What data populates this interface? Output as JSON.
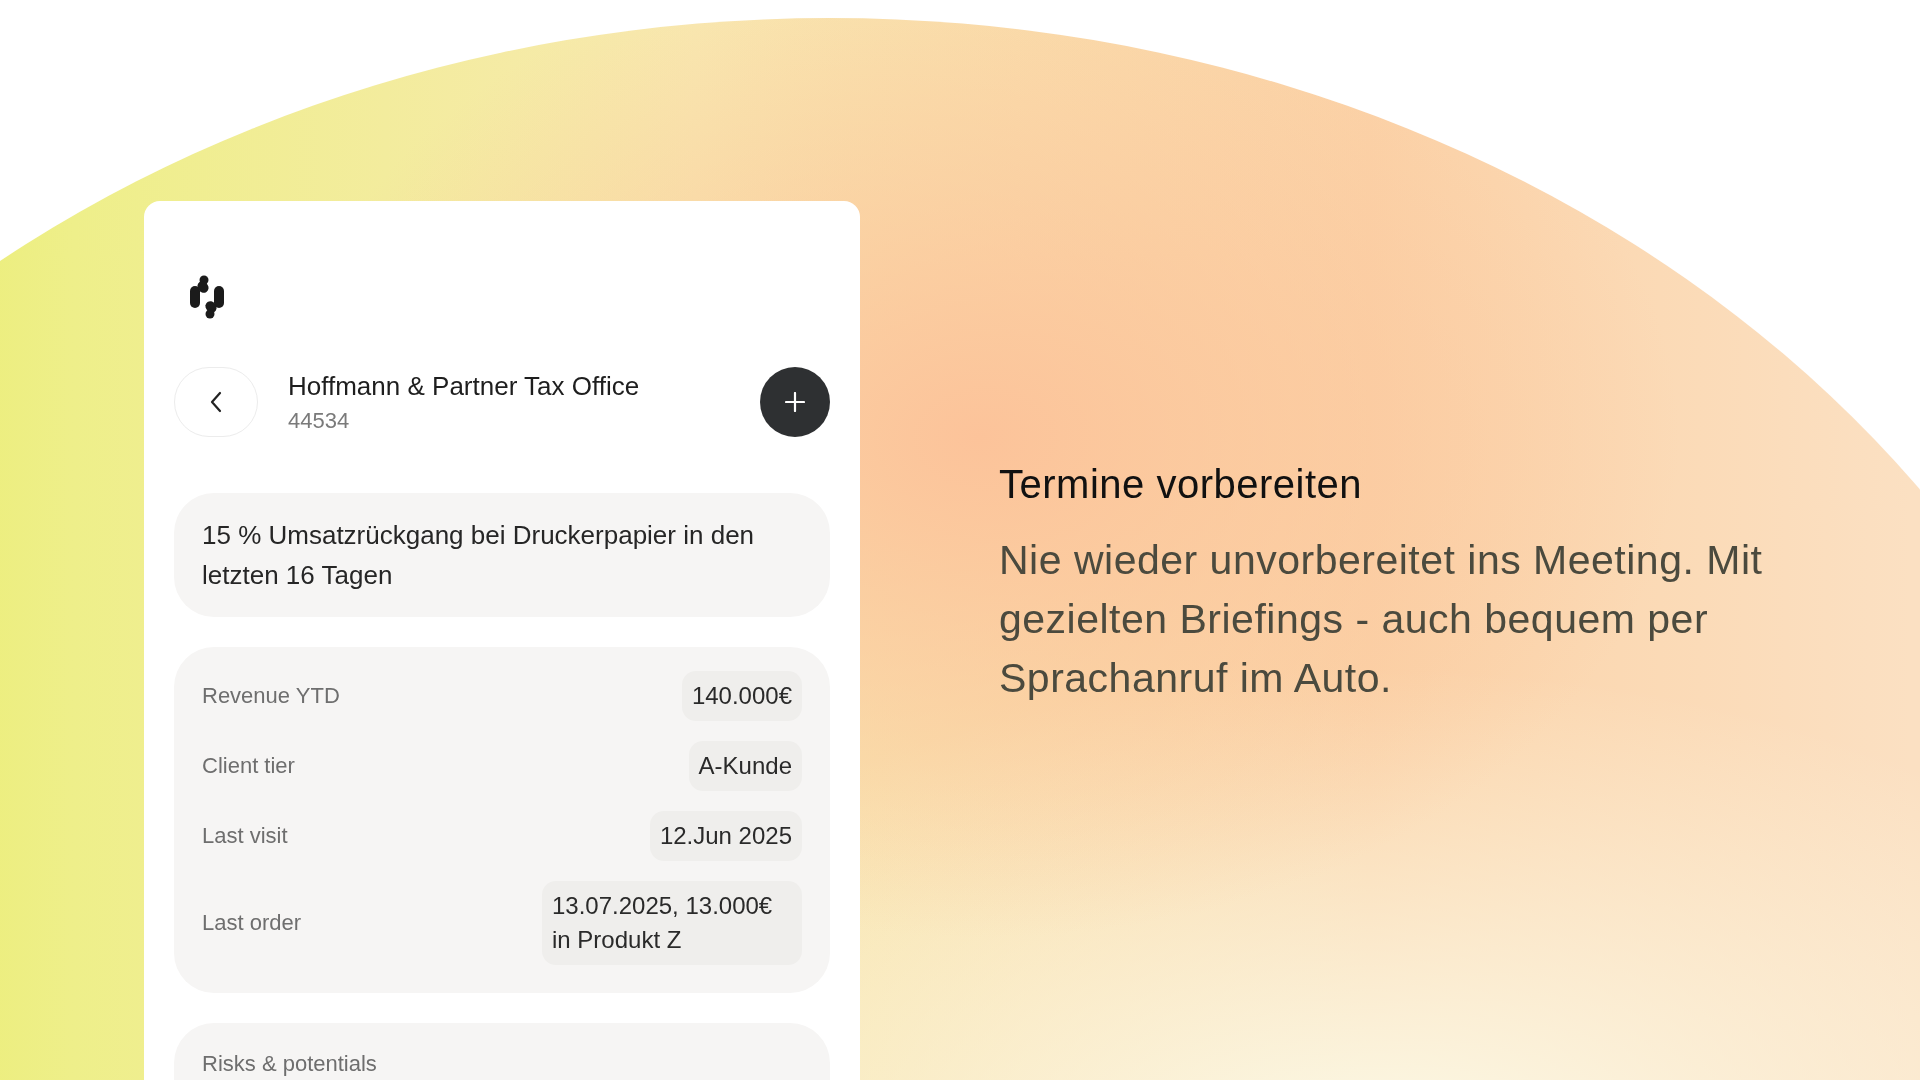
{
  "card": {
    "header": {
      "title": "Hoffmann & Partner Tax Office",
      "subtitle": "44534"
    },
    "alert": "15 % Umsatzrückgang bei Druckerpapier in den letzten 16 Tagen",
    "details": [
      {
        "label": "Revenue YTD",
        "value": "140.000€"
      },
      {
        "label": "Client tier",
        "value": "A-Kunde"
      },
      {
        "label": "Last visit",
        "value": "12.Jun 2025"
      },
      {
        "label": "Last order",
        "value": "13.07.2025, 13.000€ in Produkt Z"
      }
    ],
    "next_section": {
      "title": "Risks & potentials"
    }
  },
  "feature": {
    "heading": "Termine vorbereiten",
    "text": "Nie wieder unvorbereitet ins Meeting. Mit gezielten Briefings - auch bequem per Sprachanruf im Auto."
  }
}
